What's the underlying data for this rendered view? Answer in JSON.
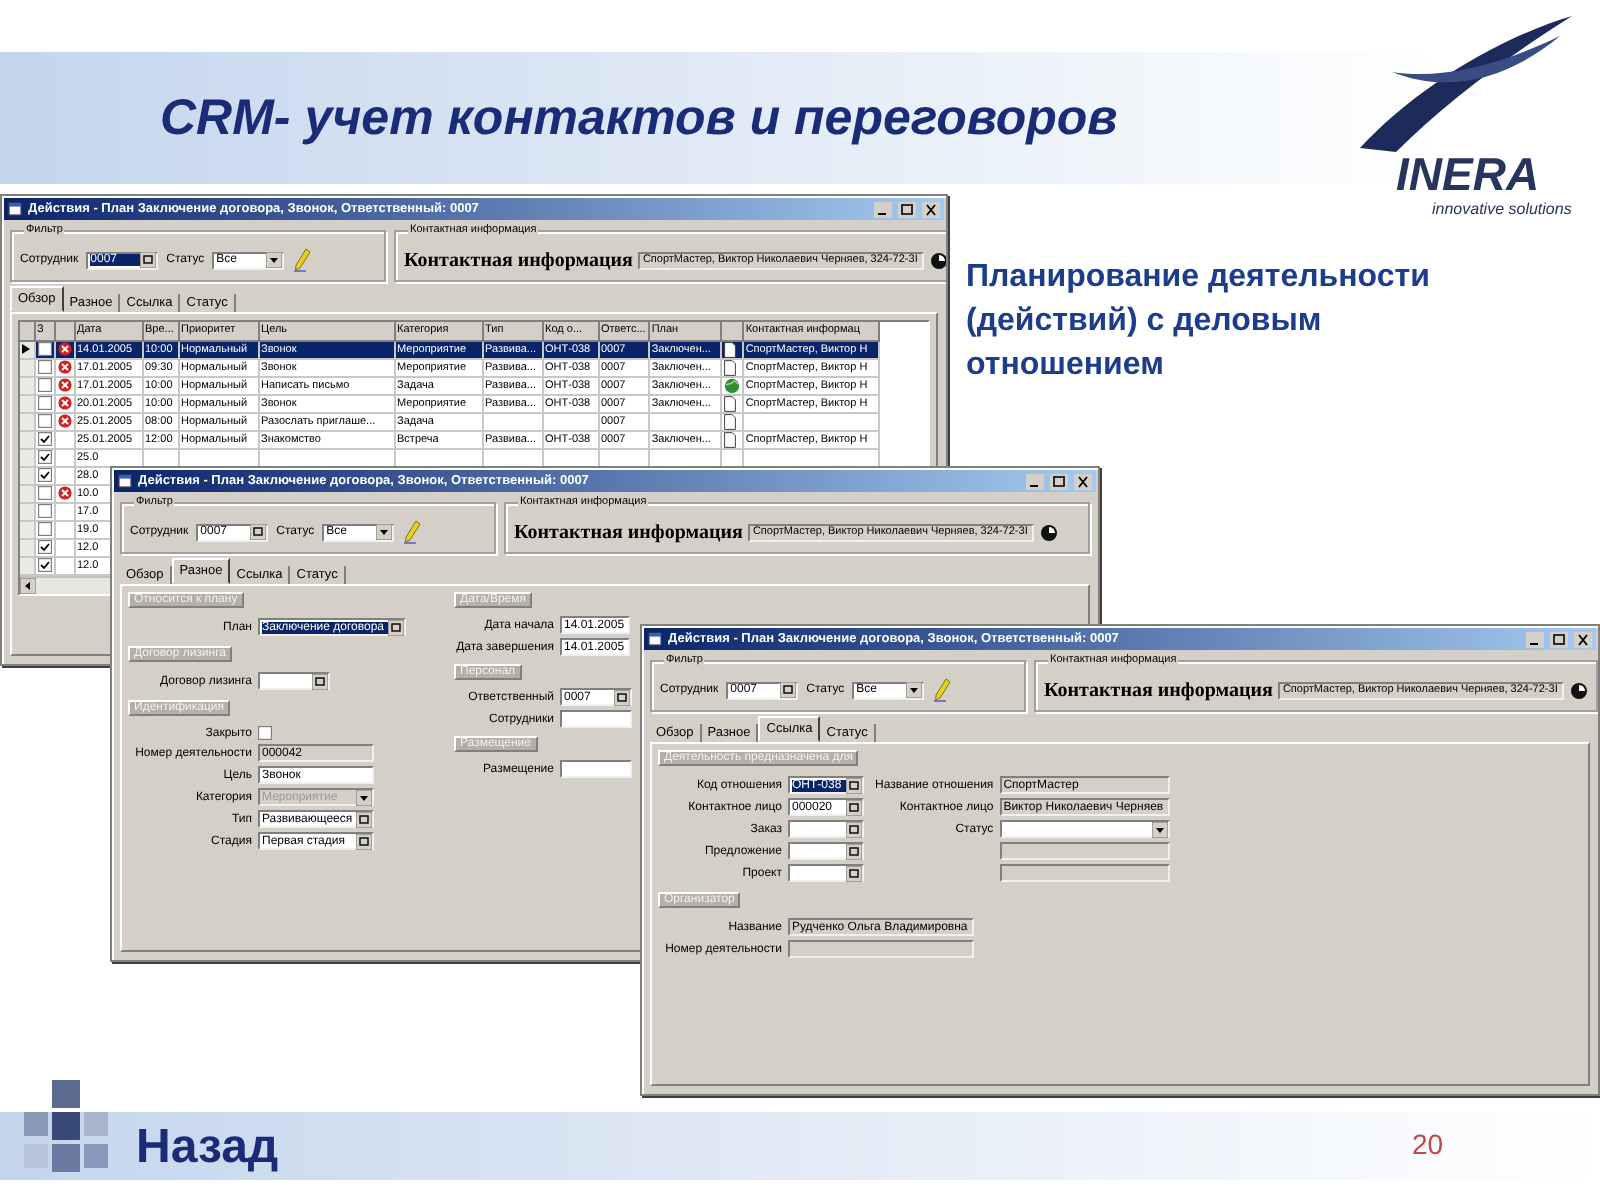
{
  "slide": {
    "title": "CRM- учет контактов и переговоров",
    "logo": {
      "name": "INERA",
      "tagline": "innovative solutions"
    },
    "caption": "Планирование деятельности (действий) с деловым отношением",
    "back_link": "Назад",
    "page_number": "20"
  },
  "windows": [
    {
      "title": "Действия - План Заключение договора, Звонок, Ответственный: 0007",
      "filter": {
        "caption": "Фильтр",
        "employee_label": "Сотрудник",
        "employee": "0007",
        "employee_highlighted": true,
        "status_label": "Статус",
        "status": "Все"
      },
      "contact": {
        "caption": "Контактная информация",
        "heading": "Контактная информация",
        "value": "СпортМастер, Виктор Николаевич Черняев, 324-72-3I"
      },
      "tabs": [
        {
          "label": "Обзор",
          "selected": true
        },
        {
          "label": "Разное",
          "selected": false
        },
        {
          "label": "Ссылка",
          "selected": false
        },
        {
          "label": "Статус",
          "selected": false
        }
      ],
      "table": {
        "check_column_label": "З",
        "columns": [
          "Дата",
          "Вре...",
          "Приоритет",
          "Цель",
          "Категория",
          "Тип",
          "Код о...",
          "Ответс...",
          "План",
          "Контактная информац"
        ],
        "rows": [
          {
            "selected": true,
            "checked": false,
            "error": true,
            "plan_icon": {
              "kind": "document"
            },
            "cells": [
              "14.01.2005",
              "10:00",
              "Нормальный",
              "Звонок",
              "Мероприятие",
              "Развива...",
              "ОНТ-038",
              "0007",
              "Заключен...",
              "СпортМастер, Виктор Н"
            ]
          },
          {
            "selected": false,
            "checked": false,
            "error": true,
            "plan_icon": {
              "kind": "document"
            },
            "cells": [
              "17.01.2005",
              "09:30",
              "Нормальный",
              "Звонок",
              "Мероприятие",
              "Развива...",
              "ОНТ-038",
              "0007",
              "Заключен...",
              "СпортМастер, Виктор Н"
            ]
          },
          {
            "selected": false,
            "checked": false,
            "error": true,
            "plan_icon": {
              "kind": "globe"
            },
            "cells": [
              "17.01.2005",
              "10:00",
              "Нормальный",
              "Написать письмо",
              "Задача",
              "Развива...",
              "ОНТ-038",
              "0007",
              "Заключен...",
              "СпортМастер, Виктор Н"
            ]
          },
          {
            "selected": false,
            "checked": false,
            "error": true,
            "plan_icon": {
              "kind": "document"
            },
            "cells": [
              "20.01.2005",
              "10:00",
              "Нормальный",
              "Звонок",
              "Мероприятие",
              "Развива...",
              "ОНТ-038",
              "0007",
              "Заключен...",
              "СпортМастер, Виктор Н"
            ]
          },
          {
            "selected": false,
            "checked": false,
            "error": true,
            "plan_icon": {
              "kind": "document"
            },
            "cells": [
              "25.01.2005",
              "08:00",
              "Нормальный",
              "Разослать приглаше...",
              "Задача",
              null,
              null,
              "0007",
              null,
              null
            ]
          },
          {
            "selected": false,
            "checked": true,
            "error": false,
            "plan_icon": {
              "kind": "document"
            },
            "cells": [
              "25.01.2005",
              "12:00",
              "Нормальный",
              "Знакомство",
              "Встреча",
              "Развива...",
              "ОНТ-038",
              "0007",
              "Заключен...",
              "СпортМастер, Виктор Н"
            ]
          },
          {
            "selected": false,
            "checked": true,
            "error": false,
            "cells": [
              "25.0"
            ]
          },
          {
            "selected": false,
            "checked": true,
            "error": false,
            "cells": [
              "28.0"
            ]
          },
          {
            "selected": false,
            "checked": false,
            "error": true,
            "cells": [
              "10.0"
            ]
          },
          {
            "selected": false,
            "checked": false,
            "error": false,
            "cells": [
              "17.0"
            ]
          },
          {
            "selected": false,
            "checked": false,
            "error": false,
            "cells": [
              "19.0"
            ]
          },
          {
            "selected": false,
            "checked": true,
            "error": false,
            "cells": [
              "12.0"
            ]
          },
          {
            "selected": false,
            "checked": true,
            "error": false,
            "cells": [
              "12.0"
            ]
          }
        ]
      }
    },
    {
      "title": "Действия - План Заключение договора, Звонок, Ответственный: 0007",
      "filter": {
        "caption": "Фильтр",
        "employee_label": "Сотрудник",
        "employee": "0007",
        "employee_highlighted": false,
        "status_label": "Статус",
        "status": "Все"
      },
      "contact": {
        "caption": "Контактная информация",
        "heading": "Контактная информация",
        "value": "СпортМастер, Виктор Николаевич Черняев, 324-72-3I"
      },
      "tabs": [
        {
          "label": "Обзор",
          "selected": false
        },
        {
          "label": "Разное",
          "selected": true
        },
        {
          "label": "Ссылка",
          "selected": false
        },
        {
          "label": "Статус",
          "selected": false
        }
      ],
      "form": {
        "columns": [
          [
            {
              "label": "Относится к плану",
              "rows": [
                [
                  {
                    "kind": "lookup",
                    "label": "План",
                    "value": "Заключение договора",
                    "highlighted": true
                  }
                ]
              ]
            },
            {
              "label": "Договор лизинга",
              "rows": [
                [
                  {
                    "kind": "lookup",
                    "label": "Договор лизинга"
                  }
                ]
              ]
            },
            {
              "label": "Идентификация",
              "rows": [
                [
                  {
                    "kind": "checkbox",
                    "label": "Закрыто",
                    "checked": false
                  }
                ],
                [
                  {
                    "kind": "readonly",
                    "label": "Номер деятельности",
                    "value": "000042"
                  }
                ],
                [
                  {
                    "kind": "text",
                    "label": "Цель",
                    "value": "Звонок"
                  }
                ],
                [
                  {
                    "kind": "combo",
                    "label": "Категория",
                    "value": "Мероприятие",
                    "disabled": true
                  }
                ],
                [
                  {
                    "kind": "lookup",
                    "label": "Тип",
                    "value": "Развивающееся"
                  }
                ],
                [
                  {
                    "kind": "lookup",
                    "label": "Стадия",
                    "value": "Первая стадия"
                  }
                ]
              ]
            }
          ],
          [
            {
              "label": "Дата/Время",
              "rows": [
                [
                  {
                    "kind": "date",
                    "label": "Дата начала",
                    "value": "14.01.2005"
                  }
                ],
                [
                  {
                    "kind": "date",
                    "label": "Дата завершения",
                    "value": "14.01.2005"
                  }
                ]
              ]
            },
            {
              "label": "Персонал",
              "rows": [
                [
                  {
                    "kind": "lookup",
                    "label": "Ответственный",
                    "value": "0007"
                  }
                ],
                [
                  {
                    "kind": "text",
                    "label": "Сотрудники"
                  }
                ]
              ]
            },
            {
              "label": "Размещение",
              "rows": [
                [
                  {
                    "kind": "text",
                    "label": "Размещение"
                  }
                ]
              ]
            }
          ]
        ]
      }
    },
    {
      "title": "Действия - План Заключение договора, Звонок, Ответственный: 0007",
      "filter": {
        "caption": "Фильтр",
        "employee_label": "Сотрудник",
        "employee": "0007",
        "employee_highlighted": false,
        "status_label": "Статус",
        "status": "Все"
      },
      "contact": {
        "caption": "Контактная информация",
        "heading": "Контактная информация",
        "value": "СпортМастер, Виктор Николаевич Черняев, 324-72-3I"
      },
      "tabs": [
        {
          "label": "Обзор",
          "selected": false
        },
        {
          "label": "Разное",
          "selected": false
        },
        {
          "label": "Ссылка",
          "selected": true
        },
        {
          "label": "Статус",
          "selected": false
        }
      ],
      "form": {
        "columns": [
          [
            {
              "label": "Деятельность предназначена для",
              "rows": [
                [
                  {
                    "kind": "lookup",
                    "label": "Код отношения",
                    "value": "ОНТ-038",
                    "highlighted": true
                  },
                  {
                    "kind": "readonly",
                    "label": "Название отношения",
                    "value": "СпортМастер"
                  }
                ],
                [
                  {
                    "kind": "lookup",
                    "label": "Контактное лицо",
                    "value": "000020"
                  },
                  {
                    "kind": "readonly",
                    "label": "Контактное лицо",
                    "value": "Виктор Николаевич Черняев"
                  }
                ],
                [
                  {
                    "kind": "lookup",
                    "label": "Заказ"
                  },
                  {
                    "kind": "combo",
                    "label": "Статус"
                  }
                ],
                [
                  {
                    "kind": "lookup",
                    "label": "Предложение"
                  },
                  {
                    "kind": "readonly"
                  }
                ],
                [
                  {
                    "kind": "lookup",
                    "label": "Проект"
                  },
                  {
                    "kind": "readonly"
                  }
                ]
              ]
            },
            {
              "label": "Организатор",
              "rows": [
                [
                  {
                    "kind": "readonly",
                    "label": "Название",
                    "value": "Рудченко Ольга Владимировна"
                  }
                ],
                [
                  {
                    "kind": "readonly",
                    "label": "Номер деятельности"
                  }
                ]
              ]
            }
          ]
        ]
      }
    }
  ]
}
